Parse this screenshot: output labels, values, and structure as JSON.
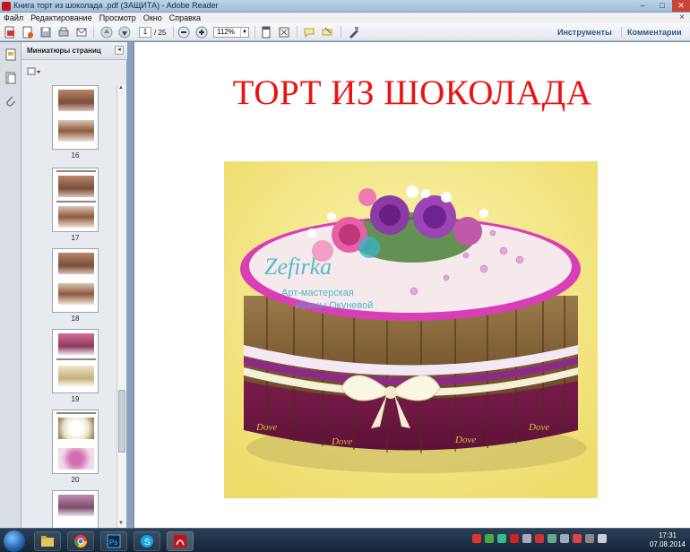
{
  "window": {
    "title": "Книга торт из шоколада .pdf (ЗАЩИТА) - Adobe Reader",
    "controls": [
      "–",
      "□",
      "✕"
    ]
  },
  "menu": [
    "Файл",
    "Редактирование",
    "Просмотр",
    "Окно",
    "Справка"
  ],
  "menu_close": "×",
  "toolbar": {
    "page_current": "1",
    "page_total": "/ 25",
    "zoom": "112%",
    "tools_label": "Инструменты",
    "comments_label": "Комментарии"
  },
  "thumbnail_panel": {
    "title": "Миниатюры страниц",
    "close": "◂",
    "pages": [
      {
        "label": "16"
      },
      {
        "label": "17"
      },
      {
        "label": "18"
      },
      {
        "label": "19"
      },
      {
        "label": "20"
      }
    ]
  },
  "document": {
    "title": "ТОРТ ИЗ ШОКОЛАДА",
    "watermark_brand": "Zefirka",
    "watermark_line1": "Арт-мастерская",
    "watermark_line2": "Ирины Окуневой",
    "candy_label": "Dove"
  },
  "taskbar": {
    "time": "17:31",
    "date": "07.08.2014"
  },
  "colors": {
    "title_red": "#ee1111",
    "photo_bg": "#f3ea86",
    "chocolate": "#8a6a3e",
    "wrapper_purple": "#8a1f5a"
  }
}
